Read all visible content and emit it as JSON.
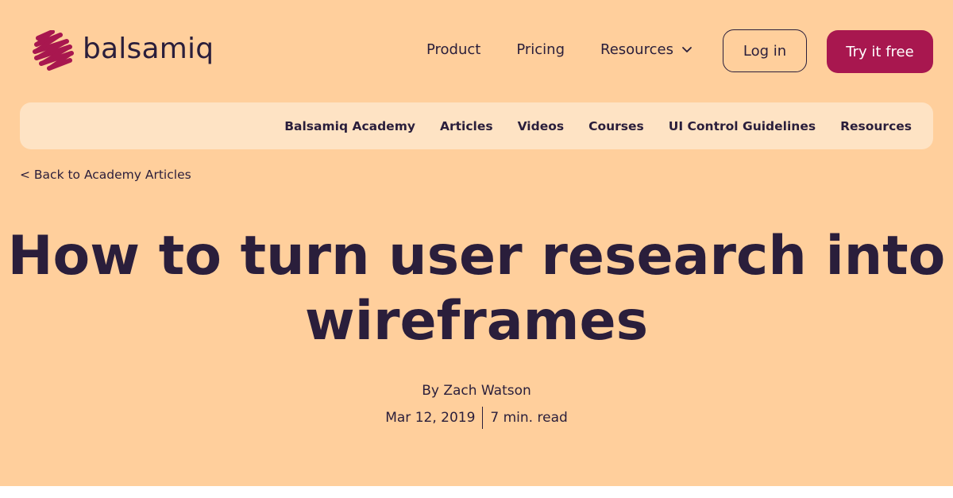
{
  "brand": {
    "name": "balsamiq",
    "icon": "scribble-logo-icon",
    "color": "#a8174f"
  },
  "header": {
    "nav": {
      "product": "Product",
      "pricing": "Pricing",
      "resources": "Resources"
    },
    "login_label": "Log in",
    "try_label": "Try it free"
  },
  "subnav": {
    "items": [
      "Balsamiq Academy",
      "Articles",
      "Videos",
      "Courses",
      "UI Control Guidelines",
      "Resources"
    ]
  },
  "back_link": "< Back to Academy Articles",
  "article": {
    "title_line1": "How to turn user research into",
    "title_line2": "wireframes",
    "author": "By Zach Watson",
    "date": "Mar 12, 2019",
    "read_time": "7 min. read"
  },
  "colors": {
    "hero_background": "#ffcf9c",
    "subnav_background": "#fee3c4",
    "text": "#2a1e3b",
    "accent": "#a8174f"
  }
}
